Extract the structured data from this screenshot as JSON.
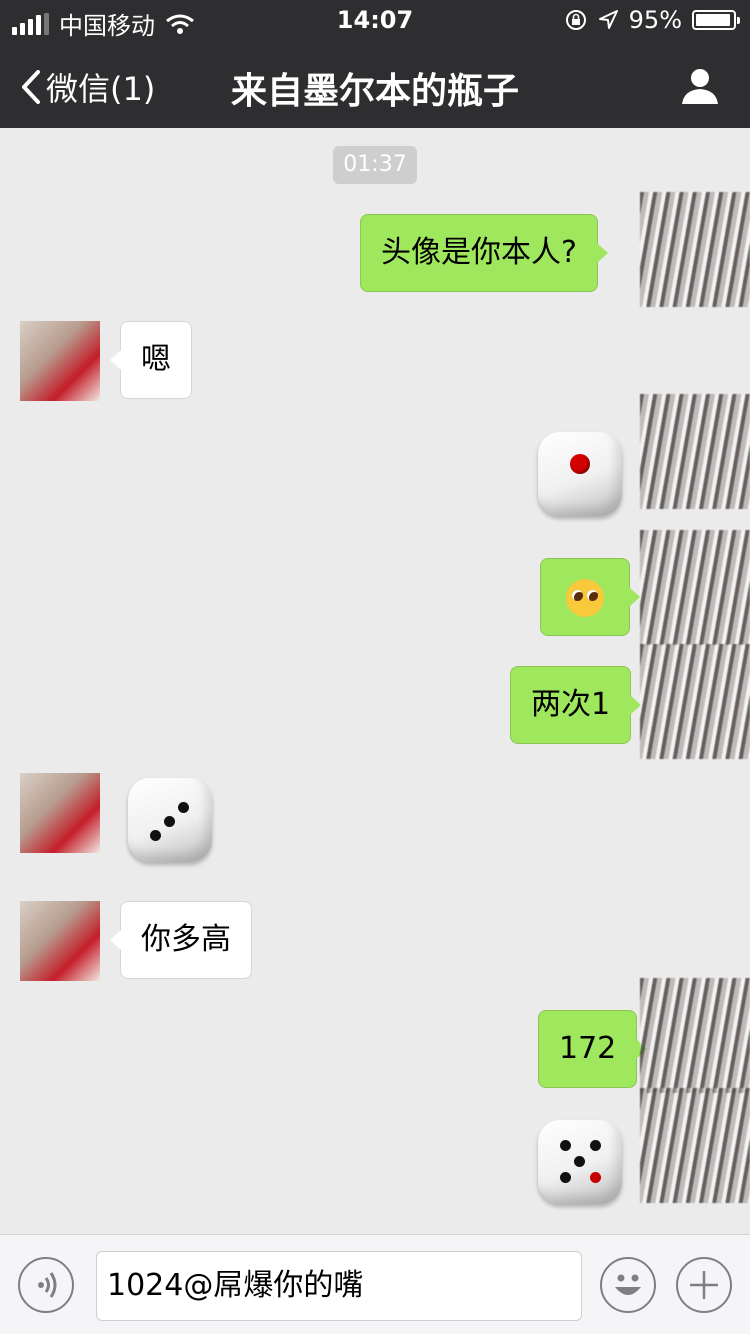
{
  "status_bar": {
    "carrier": "中国移动",
    "time": "14:07",
    "battery_percent": "95%",
    "battery_level": 0.95,
    "icons": [
      "signal-icon",
      "wifi-icon",
      "rotation-lock-icon",
      "location-arrow-icon",
      "battery-icon"
    ]
  },
  "nav": {
    "back_label": "微信(1)",
    "title": "来自墨尔本的瓶子",
    "profile_icon": "person-icon"
  },
  "chat": {
    "timestamp": "01:37",
    "messages": [
      {
        "side": "right",
        "type": "text",
        "text": "头像是你本人?"
      },
      {
        "side": "left",
        "type": "text",
        "text": "嗯"
      },
      {
        "side": "right",
        "type": "dice",
        "value": 1
      },
      {
        "side": "right",
        "type": "emoji",
        "emoji": "pleading-face-icon"
      },
      {
        "side": "right",
        "type": "text",
        "text": "两次1"
      },
      {
        "side": "left",
        "type": "dice",
        "value": 3
      },
      {
        "side": "left",
        "type": "text",
        "text": "你多高"
      },
      {
        "side": "right",
        "type": "text",
        "text": "172"
      },
      {
        "side": "right",
        "type": "dice",
        "value": 5
      }
    ]
  },
  "input_bar": {
    "voice_icon": "voice-icon",
    "text": "1024@屌爆你的嘴",
    "emoji_icon": "smiley-icon",
    "plus_icon": "plus-icon"
  },
  "colors": {
    "nav_bg": "#2e2e31",
    "chat_bg": "#ebebeb",
    "bubble_green": "#9fe85e",
    "bubble_white": "#ffffff",
    "timestamp_bg": "#cecece"
  }
}
